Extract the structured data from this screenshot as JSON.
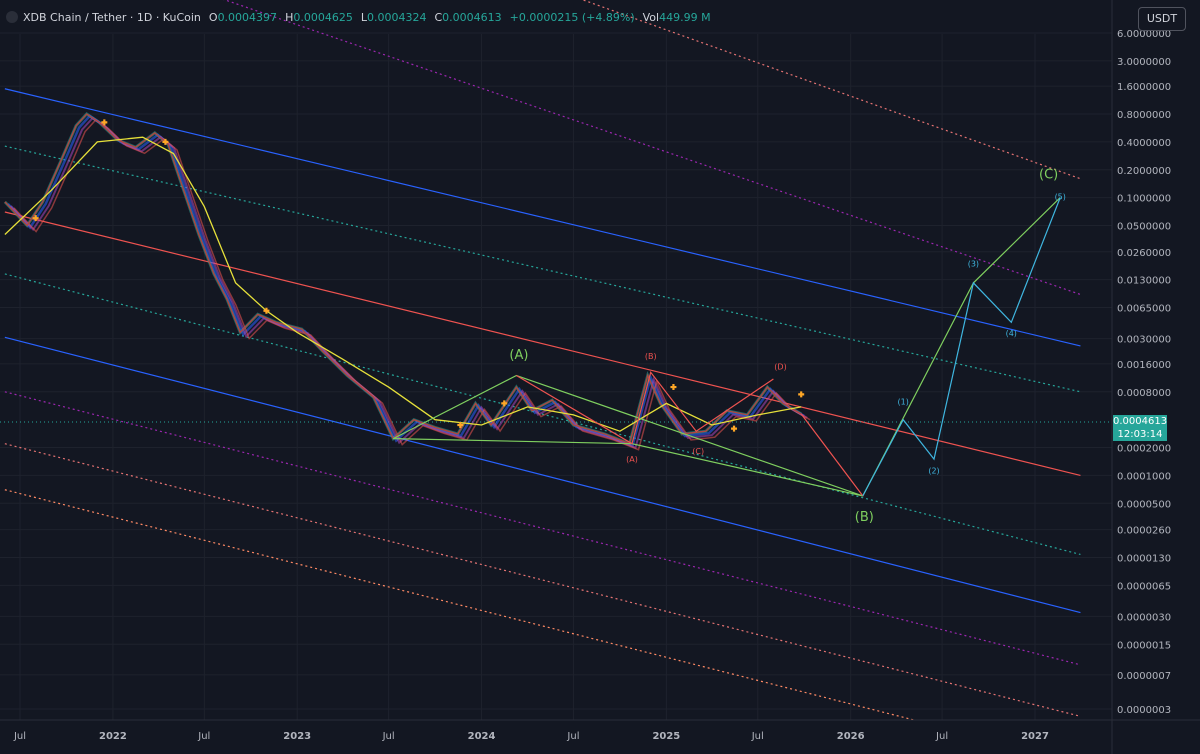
{
  "header": {
    "symbol": "XDB Chain / Tether · 1D · KuCoin",
    "open_label": "O",
    "open": "0.0004397",
    "high_label": "H",
    "high": "0.0004625",
    "low_label": "L",
    "low": "0.0004324",
    "close_label": "C",
    "close": "0.0004613",
    "change": "+0.0000215 (+4.89%)",
    "vol_label": "Vol",
    "vol": "449.99 M"
  },
  "currency_button": "USDT",
  "last_price": {
    "value": "0.0004613",
    "countdown": "12:03:14"
  },
  "colors": {
    "background": "#131722",
    "up": "#26a69a",
    "down": "#ef5350",
    "channel_blue": "#2962ff",
    "ma_yellow": "#e6e03a",
    "wave_green": "#7fcf5f",
    "wave_cyan": "#3fb6e0",
    "wave_red": "#ef5350"
  },
  "chart_data": {
    "type": "line",
    "log_scale": true,
    "grid": true,
    "y_ticks": [
      "6.0000000",
      "3.0000000",
      "1.6000000",
      "0.8000000",
      "0.4000000",
      "0.2000000",
      "0.1000000",
      "0.0500000",
      "0.0260000",
      "0.0130000",
      "0.0065000",
      "0.0030000",
      "0.0016000",
      "0.0008000",
      "0.0004613",
      "0.0002000",
      "0.0001000",
      "0.0000500",
      "0.0000260",
      "0.0000130",
      "0.0000065",
      "0.0000030",
      "0.0000015",
      "0.0000007",
      "0.0000003"
    ],
    "y_tick_values": [
      6,
      3,
      1.6,
      0.8,
      0.4,
      0.2,
      0.1,
      0.05,
      0.026,
      0.013,
      0.0065,
      0.003,
      0.0016,
      0.0008,
      0.0004613,
      0.0002,
      0.0001,
      5e-05,
      2.6e-05,
      1.3e-05,
      6.5e-06,
      3e-06,
      1.5e-06,
      7e-07,
      3e-07
    ],
    "x_ticks": [
      "Jul",
      "2022",
      "Jul",
      "2023",
      "Jul",
      "2024",
      "Jul",
      "2025",
      "Jul",
      "2026",
      "Jul",
      "2027"
    ],
    "x_tick_dates": [
      "2021-07-01",
      "2022-01-01",
      "2022-07-01",
      "2023-01-01",
      "2023-07-01",
      "2024-01-01",
      "2024-07-01",
      "2025-01-01",
      "2025-07-01",
      "2026-01-01",
      "2026-07-01",
      "2027-01-01"
    ],
    "series": [
      {
        "points": [
          [
            "2021-06-01",
            0.09
          ],
          [
            "2021-07-15",
            0.05
          ],
          [
            "2021-08-15",
            0.09
          ],
          [
            "2021-09-20",
            0.25
          ],
          [
            "2021-10-20",
            0.6
          ],
          [
            "2021-11-10",
            0.8
          ],
          [
            "2021-12-05",
            0.65
          ],
          [
            "2022-01-10",
            0.42
          ],
          [
            "2022-02-15",
            0.35
          ],
          [
            "2022-03-25",
            0.5
          ],
          [
            "2022-04-20",
            0.38
          ],
          [
            "2022-05-15",
            0.15
          ],
          [
            "2022-06-20",
            0.04
          ],
          [
            "2022-07-20",
            0.015
          ],
          [
            "2022-08-15",
            0.008
          ],
          [
            "2022-09-10",
            0.0035
          ],
          [
            "2022-10-15",
            0.0055
          ],
          [
            "2022-11-20",
            0.0045
          ],
          [
            "2023-01-10",
            0.0038
          ],
          [
            "2023-02-20",
            0.0022
          ],
          [
            "2023-04-10",
            0.0012
          ],
          [
            "2023-06-01",
            0.0007
          ],
          [
            "2023-07-10",
            0.00025
          ],
          [
            "2023-08-20",
            0.0004
          ],
          [
            "2023-10-01",
            0.00033
          ],
          [
            "2023-11-15",
            0.00028
          ],
          [
            "2023-12-20",
            0.0006
          ],
          [
            "2024-01-20",
            0.00035
          ],
          [
            "2024-03-10",
            0.0009
          ],
          [
            "2024-04-10",
            0.0005
          ],
          [
            "2024-05-20",
            0.00065
          ],
          [
            "2024-07-01",
            0.00035
          ],
          [
            "2024-09-01",
            0.00028
          ],
          [
            "2024-10-20",
            0.00022
          ],
          [
            "2024-11-25",
            0.0012
          ],
          [
            "2024-12-20",
            0.0006
          ],
          [
            "2025-02-01",
            0.00028
          ],
          [
            "2025-03-20",
            0.0003
          ],
          [
            "2025-05-01",
            0.0005
          ],
          [
            "2025-06-10",
            0.00045
          ],
          [
            "2025-07-20",
            0.0009
          ],
          [
            "2025-08-20",
            0.0006
          ],
          [
            "2025-09-25",
            0.0004613
          ]
        ]
      },
      {
        "points": [
          [
            "2021-06-01",
            0.04
          ],
          [
            "2021-09-01",
            0.12
          ],
          [
            "2021-12-01",
            0.4
          ],
          [
            "2022-03-01",
            0.45
          ],
          [
            "2022-05-01",
            0.3
          ],
          [
            "2022-07-01",
            0.08
          ],
          [
            "2022-09-01",
            0.012
          ],
          [
            "2022-11-01",
            0.006
          ],
          [
            "2023-01-01",
            0.0035
          ],
          [
            "2023-04-01",
            0.0018
          ],
          [
            "2023-07-01",
            0.0009
          ],
          [
            "2023-10-01",
            0.0004
          ],
          [
            "2024-01-01",
            0.00035
          ],
          [
            "2024-04-01",
            0.00055
          ],
          [
            "2024-07-01",
            0.00045
          ],
          [
            "2024-10-01",
            0.0003
          ],
          [
            "2025-01-01",
            0.0006
          ],
          [
            "2025-04-01",
            0.00035
          ],
          [
            "2025-07-01",
            0.00045
          ],
          [
            "2025-09-25",
            0.00055
          ]
        ]
      }
    ],
    "channel_lines": [
      {
        "name": "upper-red-orange-3",
        "color": "#e57373",
        "dash": "2,3",
        "points": [
          [
            "2021-06-01",
            2400
          ],
          [
            "2027-04-01",
            0.16
          ]
        ]
      },
      {
        "name": "upper-purple-3",
        "color": "#9c27b0",
        "dash": "2,3",
        "points": [
          [
            "2021-06-01",
            90
          ],
          [
            "2027-04-01",
            0.009
          ]
        ]
      },
      {
        "name": "upper-blue",
        "color": "#2962ff",
        "dash": "",
        "points": [
          [
            "2021-06-01",
            1.5
          ],
          [
            "2027-04-01",
            0.0025
          ]
        ]
      },
      {
        "name": "upper-teal",
        "color": "#26a69a",
        "dash": "2,3",
        "points": [
          [
            "2021-06-01",
            0.36
          ],
          [
            "2027-04-01",
            0.0008
          ]
        ]
      },
      {
        "name": "mid-red",
        "color": "#ef5350",
        "dash": "",
        "points": [
          [
            "2021-06-01",
            0.07
          ],
          [
            "2027-04-01",
            0.0001
          ]
        ]
      },
      {
        "name": "lower-teal",
        "color": "#26a69a",
        "dash": "2,3",
        "points": [
          [
            "2021-06-01",
            0.015
          ],
          [
            "2027-04-01",
            1.4e-05
          ]
        ]
      },
      {
        "name": "lower-blue",
        "color": "#2962ff",
        "dash": "",
        "points": [
          [
            "2021-06-01",
            0.0031
          ],
          [
            "2027-04-01",
            3.3e-06
          ]
        ]
      },
      {
        "name": "lower-purple-1",
        "color": "#9c27b0",
        "dash": "2,3",
        "points": [
          [
            "2021-06-01",
            0.0008
          ],
          [
            "2027-04-01",
            9e-07
          ]
        ]
      },
      {
        "name": "lower-red-orange-1",
        "color": "#e57373",
        "dash": "2,3",
        "points": [
          [
            "2021-06-01",
            0.00022
          ],
          [
            "2027-04-01",
            2.5e-07
          ]
        ]
      },
      {
        "name": "lower-orange-2",
        "color": "#ff8a65",
        "dash": "2,3",
        "points": [
          [
            "2021-06-01",
            7e-05
          ],
          [
            "2027-04-01",
            8e-08
          ]
        ]
      }
    ],
    "wave_lines": [
      {
        "name": "green-abc-path",
        "color": "#7fcf5f",
        "points": [
          [
            "2023-07-10",
            0.00025
          ],
          [
            "2024-03-10",
            0.0012
          ],
          [
            "2026-01-25",
            6e-05
          ],
          [
            "2026-09-01",
            0.012
          ],
          [
            "2027-02-20",
            0.1
          ]
        ]
      },
      {
        "name": "green-lower-leg",
        "color": "#7fcf5f",
        "points": [
          [
            "2023-07-10",
            0.00025
          ],
          [
            "2024-10-25",
            0.00022
          ],
          [
            "2026-01-25",
            6e-05
          ]
        ]
      },
      {
        "name": "red-projection",
        "color": "#ef5350",
        "points": [
          [
            "2025-09-25",
            0.0004613
          ],
          [
            "2026-01-25",
            6e-05
          ]
        ]
      },
      {
        "name": "cyan-impulse",
        "color": "#3fb6e0",
        "points": [
          [
            "2026-01-25",
            6e-05
          ],
          [
            "2026-04-15",
            0.0004
          ],
          [
            "2026-06-15",
            0.00015
          ],
          [
            "2026-09-01",
            0.012
          ],
          [
            "2026-11-15",
            0.0045
          ],
          [
            "2027-02-20",
            0.1
          ]
        ]
      },
      {
        "name": "red-sub-wave",
        "color": "#ef5350",
        "points": [
          [
            "2024-03-10",
            0.0012
          ],
          [
            "2024-10-25",
            0.00022
          ],
          [
            "2024-12-01",
            0.0013
          ],
          [
            "2025-03-01",
            0.0003
          ],
          [
            "2025-08-01",
            0.0011
          ]
        ]
      }
    ],
    "annotations": [
      {
        "text": "(A)",
        "color": "#7fcf5f",
        "date": "2024-03-15",
        "value": 0.0018,
        "size": 13
      },
      {
        "text": "(B)",
        "color": "#7fcf5f",
        "date": "2026-01-28",
        "value": 3.2e-05,
        "size": 13
      },
      {
        "text": "(C)",
        "color": "#7fcf5f",
        "date": "2027-01-28",
        "value": 0.16,
        "size": 13
      },
      {
        "text": "(A)",
        "color": "#ef5350",
        "date": "2024-10-25",
        "value": 0.00014,
        "size": 8
      },
      {
        "text": "(B)",
        "color": "#ef5350",
        "date": "2024-12-01",
        "value": 0.0018,
        "size": 8
      },
      {
        "text": "(C)",
        "color": "#ef5350",
        "date": "2025-03-05",
        "value": 0.00017,
        "size": 8
      },
      {
        "text": "(D)",
        "color": "#ef5350",
        "date": "2025-08-15",
        "value": 0.0014,
        "size": 8
      },
      {
        "text": "(1)",
        "color": "#3fb6e0",
        "date": "2026-04-15",
        "value": 0.00058,
        "size": 8
      },
      {
        "text": "(2)",
        "color": "#3fb6e0",
        "date": "2026-06-15",
        "value": 0.000105,
        "size": 8
      },
      {
        "text": "(3)",
        "color": "#3fb6e0",
        "date": "2026-09-01",
        "value": 0.018,
        "size": 8
      },
      {
        "text": "(4)",
        "color": "#3fb6e0",
        "date": "2026-11-15",
        "value": 0.0032,
        "size": 8
      },
      {
        "text": "(5)",
        "color": "#3fb6e0",
        "date": "2027-02-20",
        "value": 0.095,
        "size": 8
      }
    ],
    "markers": [
      {
        "date": "2021-08-01",
        "value": 0.06
      },
      {
        "date": "2021-12-15",
        "value": 0.65
      },
      {
        "date": "2022-04-15",
        "value": 0.4
      },
      {
        "date": "2022-11-01",
        "value": 0.006
      },
      {
        "date": "2023-11-20",
        "value": 0.00035
      },
      {
        "date": "2024-02-15",
        "value": 0.0006
      },
      {
        "date": "2025-01-15",
        "value": 0.0009
      },
      {
        "date": "2025-05-15",
        "value": 0.00032
      },
      {
        "date": "2025-09-25",
        "value": 0.00075
      }
    ]
  }
}
